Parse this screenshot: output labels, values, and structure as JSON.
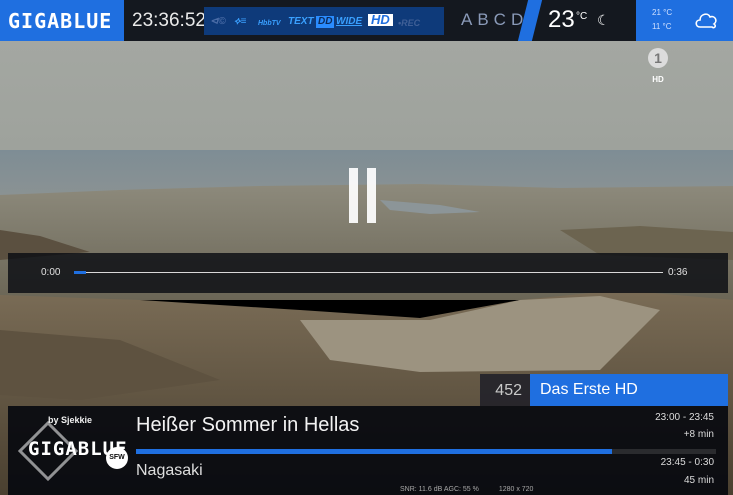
{
  "topbar": {
    "brand": "GIGABLUE",
    "clock": "23:36:52",
    "flags": [
      "⊲©",
      "⟡≡",
      "HbbTV",
      "TEXT",
      "DD",
      "WIDE",
      "HD",
      "•REC"
    ],
    "abcd": "ABCD",
    "temperature": "23",
    "temperature_unit": "°C",
    "moon_icon": "moon-icon",
    "weather_high": "21 °C",
    "weather_low": "11 °C",
    "weather_icon": "cloud-icon"
  },
  "channel_logo": {
    "name": "1",
    "hd": "HD"
  },
  "playback": {
    "state": "paused",
    "elapsed": "0:00",
    "duration": "0:36",
    "progress": 0.02
  },
  "channel": {
    "number": "452",
    "name": "Das Erste HD"
  },
  "epg": {
    "by_label": "by Sjekkie",
    "skin_logo": "GIGABLUE",
    "badge": "SFW",
    "now": {
      "title": "Heißer Sommer in Hellas",
      "time": "23:00  -  23:45",
      "remaining": "+8 min"
    },
    "now_progress": 0.82,
    "next": {
      "title": "Nagasaki",
      "time": "23:45  -  0:30",
      "duration": "45 min"
    },
    "signal": {
      "snr": "SNR: 11.6 dB",
      "agc": "AGC: 55 %",
      "resolution": "1280 x 720"
    }
  },
  "colors": {
    "accent": "#1f6fe0",
    "panel": "#06080e"
  }
}
